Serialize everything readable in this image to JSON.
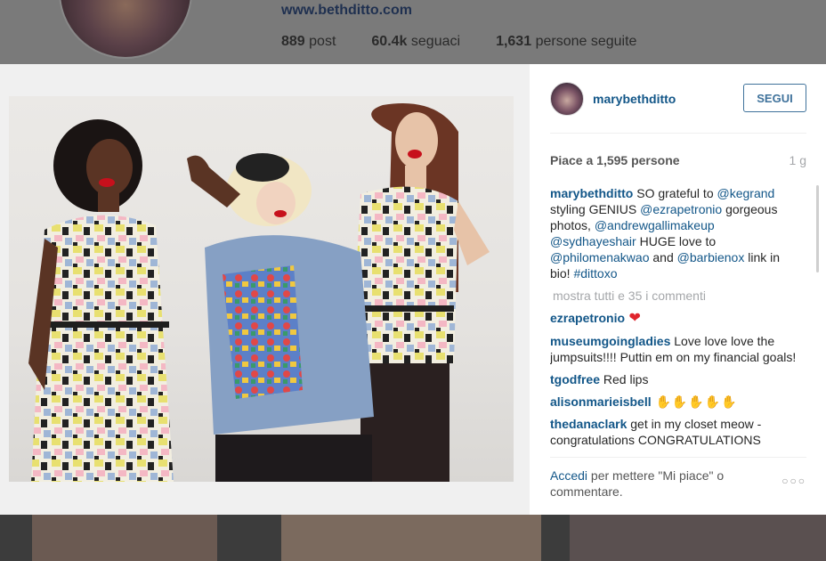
{
  "background_profile": {
    "website": "www.bethditto.com",
    "stats": [
      {
        "value": "889",
        "label": "post"
      },
      {
        "value": "60.4k",
        "label": "seguaci"
      },
      {
        "value": "1,631",
        "label": "persone seguite"
      }
    ]
  },
  "post": {
    "username": "marybethditto",
    "follow_label": "SEGUI",
    "likes_text": "Piace a 1,595 persone",
    "age": "1 g",
    "caption": {
      "user": "marybethditto",
      "parts": [
        {
          "t": " SO grateful to ",
          "m": false
        },
        {
          "t": "@kegrand",
          "m": true
        },
        {
          "t": " styling GENIUS ",
          "m": false
        },
        {
          "t": "@ezrapetronio",
          "m": true
        },
        {
          "t": " gorgeous photos, ",
          "m": false
        },
        {
          "t": "@andrewgallimakeup",
          "m": true
        },
        {
          "t": " ",
          "m": false
        },
        {
          "t": "@sydhayeshair",
          "m": true
        },
        {
          "t": " HUGE love to ",
          "m": false
        },
        {
          "t": "@philomenakwao",
          "m": true
        },
        {
          "t": " and ",
          "m": false
        },
        {
          "t": "@barbienox",
          "m": true
        },
        {
          "t": " link in bio! ",
          "m": false
        },
        {
          "t": "#dittoxo",
          "m": true
        }
      ]
    },
    "show_all_comments": "mostra tutti e 35 i commenti",
    "comments": [
      {
        "user": "ezrapetronio",
        "text": "",
        "emoji": "heart"
      },
      {
        "user": "museumgoingladies",
        "text": " Love love love the jumpsuits!!!! Puttin em on my financial goals!",
        "emoji": ""
      },
      {
        "user": "tgodfree",
        "text": " Red lips",
        "emoji": ""
      },
      {
        "user": "alisonmarieisbell",
        "text": "",
        "emoji": "claps"
      },
      {
        "user": "thedanaclark",
        "text": " get in my closet meow - congratulations CONGRATULATIONS",
        "emoji": ""
      }
    ],
    "footer": {
      "login_link": "Accedi",
      "login_text": " per mettere \"Mi piace\" o commentare.",
      "more_icon": "ellipsis-icon"
    }
  },
  "colors": {
    "link": "#125688",
    "follow_border": "#3f729b",
    "heart": "#e0242c",
    "muted": "#a5a7aa"
  }
}
